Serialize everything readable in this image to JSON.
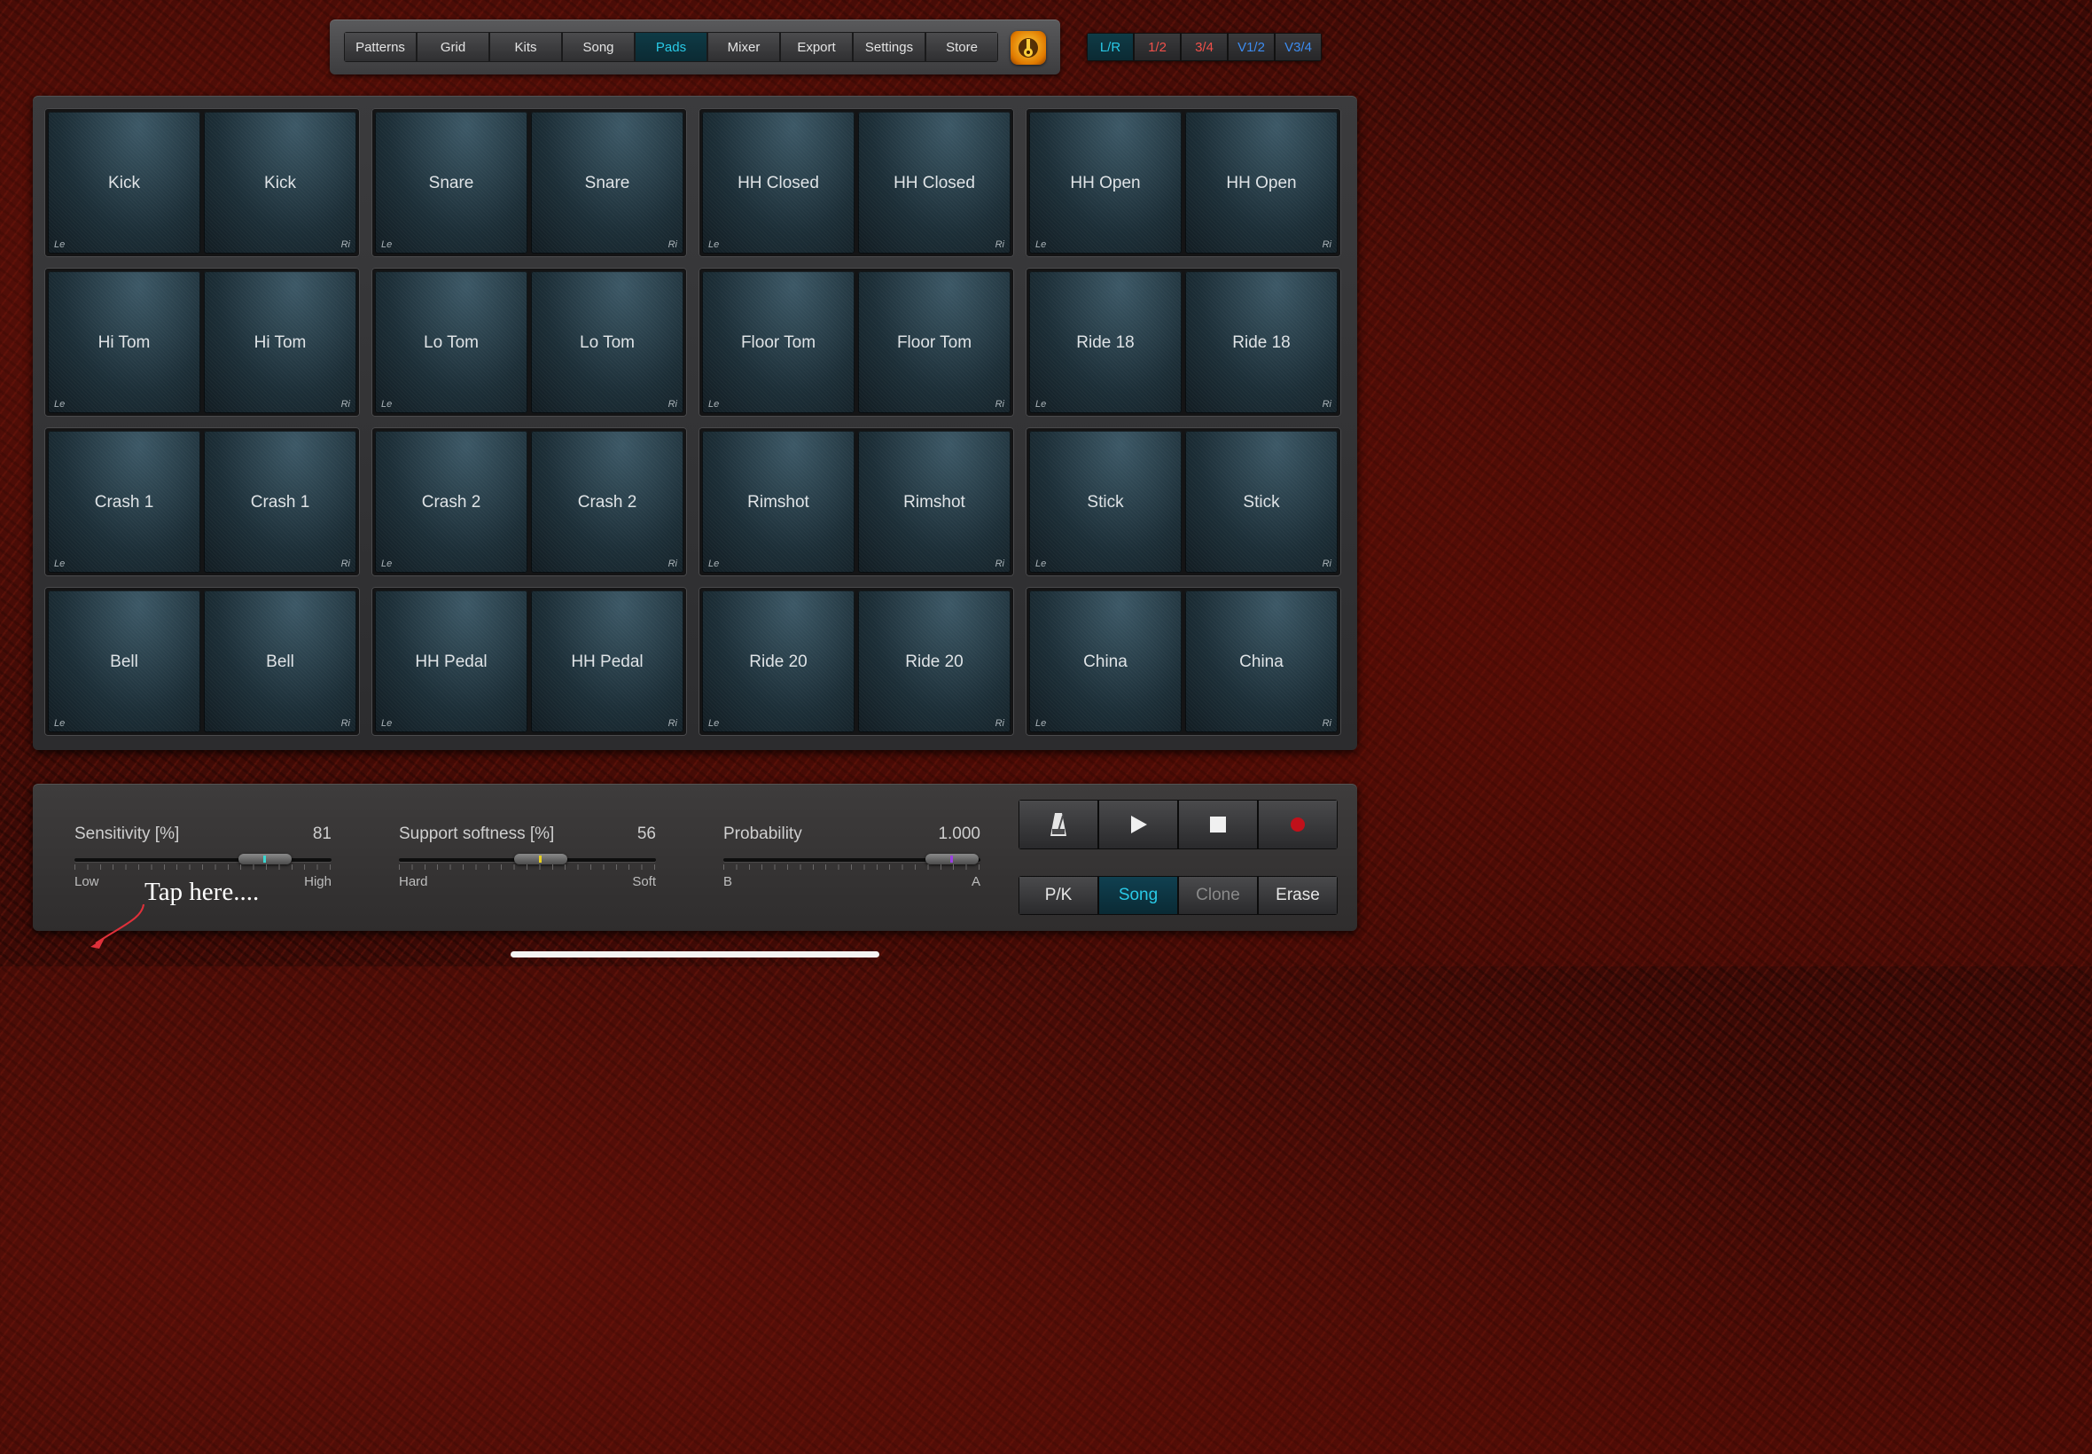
{
  "nav": {
    "tabs": [
      "Patterns",
      "Grid",
      "Kits",
      "Song",
      "Pads",
      "Mixer",
      "Export",
      "Settings",
      "Store"
    ],
    "active_tab": "Pads",
    "logo_icon": "drum-logo-icon"
  },
  "channels": [
    {
      "label": "L/R",
      "color": "#29c9e6",
      "active": true
    },
    {
      "label": "1/2",
      "color": "#f0504a",
      "active": false
    },
    {
      "label": "3/4",
      "color": "#f0504a",
      "active": false
    },
    {
      "label": "V1/2",
      "color": "#3d8cf0",
      "active": false
    },
    {
      "label": "V3/4",
      "color": "#3d8cf0",
      "active": false
    }
  ],
  "pads": {
    "left_tag": "Le",
    "right_tag": "Ri",
    "rows": [
      [
        "Kick",
        "Snare",
        "HH Closed",
        "HH Open"
      ],
      [
        "Hi Tom",
        "Lo Tom",
        "Floor Tom",
        "Ride 18"
      ],
      [
        "Crash 1",
        "Crash 2",
        "Rimshot",
        "Stick"
      ],
      [
        "Bell",
        "HH Pedal",
        "Ride 20",
        "China"
      ]
    ]
  },
  "sliders": [
    {
      "label": "Sensitivity [%]",
      "value": "81",
      "fraction": 0.74,
      "low": "Low",
      "high": "High",
      "mark_color": "#3ad6d0"
    },
    {
      "label": "Support softness [%]",
      "value": "56",
      "fraction": 0.55,
      "low": "Hard",
      "high": "Soft",
      "mark_color": "#e8d020"
    },
    {
      "label": "Probability",
      "value": "1.000",
      "fraction": 0.89,
      "low": "B",
      "high": "A",
      "mark_color": "#9a40e0"
    }
  ],
  "transport": {
    "buttons": [
      "metronome-icon",
      "play-icon",
      "stop-icon",
      "record-icon"
    ],
    "record_color": "#c0101a"
  },
  "modes": {
    "buttons": [
      "P/K",
      "Song",
      "Clone",
      "Erase"
    ],
    "active": "Song",
    "dimmed": "Clone"
  },
  "annotation": {
    "text": "Tap here....",
    "arrow_color": "#e0303a"
  }
}
